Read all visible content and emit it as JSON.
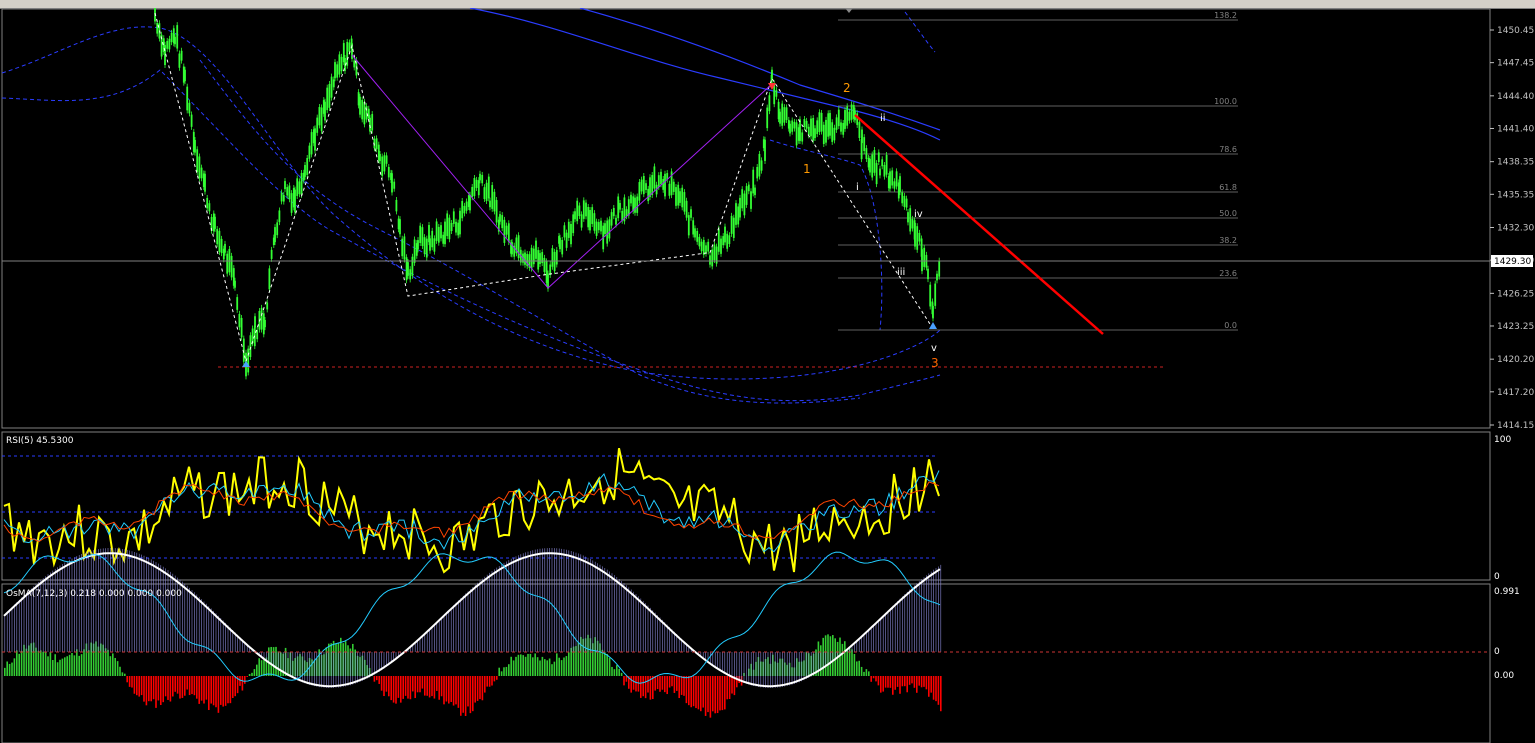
{
  "main_panel": {
    "price_ticks": [
      "1450.45",
      "1447.45",
      "1444.40",
      "1441.40",
      "1438.35",
      "1435.35",
      "1432.30",
      "1429.30",
      "1426.25",
      "1423.25",
      "1420.20",
      "1417.20",
      "1414.15"
    ],
    "current_price": "1429.30",
    "fib_levels": [
      "138.2",
      "100.0",
      "78.6",
      "61.8",
      "50.0",
      "38.2",
      "23.6",
      "0.0"
    ],
    "wave_labels": {
      "w1": "1",
      "w2": "2",
      "w3": "3",
      "wi": "i",
      "wii": "ii",
      "wiii": "iii",
      "wiv": "iv",
      "wv": "v"
    }
  },
  "rsi_panel": {
    "title": "RSI(5) 45.5300",
    "scale_top": "100",
    "scale_bottom": "0"
  },
  "osma_panel": {
    "title": "OsMA(7,12,3) 0.218 0.000 0.000 0.000",
    "scale_top": "0.991",
    "scale_zero": "0",
    "scale_mid": "0.00"
  },
  "chart_data": {
    "type": "candlestick",
    "instrument_scale": {
      "ylim": [
        1414.15,
        1451.0
      ]
    },
    "price_path": [
      [
        155,
        1452.0
      ],
      [
        165,
        1448.5
      ],
      [
        175,
        1450.0
      ],
      [
        185,
        1446.0
      ],
      [
        195,
        1440.0
      ],
      [
        205,
        1436.0
      ],
      [
        215,
        1432.0
      ],
      [
        225,
        1430.0
      ],
      [
        235,
        1427.0
      ],
      [
        246,
        1420.0
      ],
      [
        255,
        1423.0
      ],
      [
        265,
        1424.0
      ],
      [
        275,
        1432.0
      ],
      [
        285,
        1436.0
      ],
      [
        295,
        1435.0
      ],
      [
        305,
        1438.0
      ],
      [
        315,
        1441.0
      ],
      [
        325,
        1443.0
      ],
      [
        335,
        1446.0
      ],
      [
        345,
        1448.0
      ],
      [
        352,
        1449.0
      ],
      [
        360,
        1444.0
      ],
      [
        370,
        1442.0
      ],
      [
        380,
        1439.0
      ],
      [
        392,
        1437.0
      ],
      [
        400,
        1432.0
      ],
      [
        408,
        1428.0
      ],
      [
        418,
        1431.0
      ],
      [
        430,
        1431.0
      ],
      [
        445,
        1432.0
      ],
      [
        460,
        1433.0
      ],
      [
        470,
        1435.0
      ],
      [
        480,
        1437.0
      ],
      [
        490,
        1435.0
      ],
      [
        500,
        1433.0
      ],
      [
        512,
        1431.0
      ],
      [
        525,
        1430.0
      ],
      [
        540,
        1429.5
      ],
      [
        548,
        1428.0
      ],
      [
        560,
        1431.0
      ],
      [
        575,
        1433.0
      ],
      [
        590,
        1433.5
      ],
      [
        605,
        1432.0
      ],
      [
        620,
        1434.0
      ],
      [
        635,
        1435.0
      ],
      [
        650,
        1436.0
      ],
      [
        665,
        1436.5
      ],
      [
        680,
        1435.0
      ],
      [
        695,
        1432.0
      ],
      [
        710,
        1430.0
      ],
      [
        725,
        1431.0
      ],
      [
        740,
        1434.0
      ],
      [
        755,
        1436.0
      ],
      [
        765,
        1440.0
      ],
      [
        772,
        1446.0
      ],
      [
        780,
        1443.0
      ],
      [
        790,
        1442.0
      ],
      [
        800,
        1441.0
      ],
      [
        815,
        1441.5
      ],
      [
        830,
        1441.5
      ],
      [
        845,
        1442.0
      ],
      [
        855,
        1442.5
      ],
      [
        862,
        1440.0
      ],
      [
        870,
        1438.0
      ],
      [
        880,
        1438.0
      ],
      [
        890,
        1437.0
      ],
      [
        900,
        1436.0
      ],
      [
        908,
        1434.0
      ],
      [
        915,
        1432.0
      ],
      [
        922,
        1430.0
      ],
      [
        928,
        1428.0
      ],
      [
        933,
        1425.0
      ],
      [
        937,
        1427.0
      ],
      [
        941,
        1430.0
      ]
    ],
    "fib_retracement": {
      "levels": [
        138.2,
        100.0,
        78.6,
        61.8,
        50.0,
        38.2,
        23.6,
        0.0
      ]
    },
    "zigzag": [
      [
        155,
        1452.0
      ],
      [
        246,
        1420.0
      ],
      [
        352,
        1449.0
      ],
      [
        408,
        1426.0
      ],
      [
        548,
        1428.0
      ],
      [
        710,
        1430.0
      ],
      [
        772,
        1446.0
      ],
      [
        933,
        1423.0
      ]
    ],
    "rsi_series": {
      "name": "RSI(5)",
      "last": 45.53
    },
    "osma": {
      "name": "OsMA(7,12,3)",
      "last": 0.218
    }
  },
  "colors": {
    "background": "#000000",
    "grid_text": "#c0c0c0",
    "candle": "#33ff33",
    "trend_red": "#ff0000",
    "ma_blue": "#2a3cff",
    "fib": "#808080",
    "rsi": "#ffff00",
    "osma_pos": "#33cc33",
    "osma_neg": "#ff0000"
  }
}
